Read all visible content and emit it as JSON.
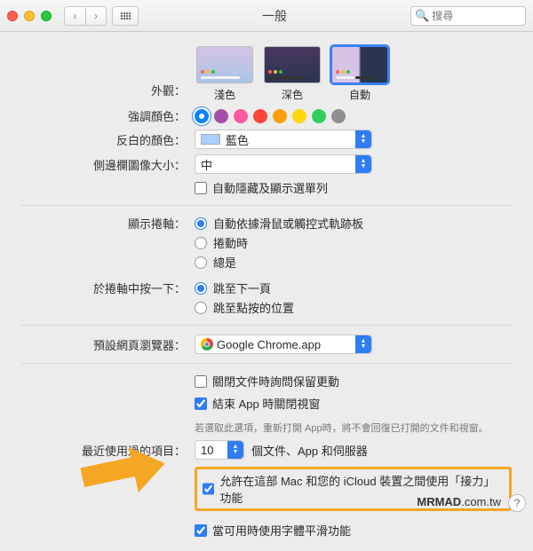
{
  "window": {
    "title": "一般"
  },
  "search": {
    "placeholder": "搜尋"
  },
  "appearance": {
    "label": "外觀：",
    "themes": [
      {
        "name": "淺色",
        "selected": false
      },
      {
        "name": "深色",
        "selected": false
      },
      {
        "name": "自動",
        "selected": true
      }
    ]
  },
  "accent": {
    "label": "強調顏色：",
    "colors": [
      "#0a84ff",
      "#a550a7",
      "#ff5a9e",
      "#ff453a",
      "#ff9f0a",
      "#ffd60a",
      "#30d158",
      "#8e8e93"
    ],
    "selected": 0
  },
  "highlight": {
    "label": "反白的顏色：",
    "value": "藍色",
    "swatch": "#a9d0ff"
  },
  "sidebarSize": {
    "label": "側邊欄圖像大小：",
    "value": "中"
  },
  "autoHideMenu": {
    "checked": false,
    "label": "自動隱藏及顯示選單列"
  },
  "scrollbar": {
    "label": "顯示捲軸：",
    "options": [
      "自動依據滑鼠或觸控式軌跡板",
      "捲動時",
      "總是"
    ],
    "selected": 0
  },
  "scrollbarClick": {
    "label": "於捲軸中按一下：",
    "options": [
      "跳至下一頁",
      "跳至點按的位置"
    ],
    "selected": 0
  },
  "browser": {
    "label": "預設網頁瀏覽器：",
    "value": "Google Chrome.app"
  },
  "docs": {
    "askKeep": {
      "checked": false,
      "label": "關閉文件時詢問保留更動"
    },
    "closeWin": {
      "checked": true,
      "label": "結束 App 時關閉視窗"
    },
    "note": "若選取此選項，重新打開 App時，將不會回復已打開的文件和視窗。"
  },
  "recent": {
    "label": "最近使用過的項目：",
    "count": "10",
    "suffix": "個文件、App 和伺服器"
  },
  "handoff": {
    "checked": true,
    "label": "允許在這部 Mac 和您的 iCloud 裝置之間使用「接力」功能"
  },
  "fontSmoothing": {
    "checked": true,
    "label": "當可用時使用字體平滑功能"
  },
  "watermark": {
    "bold": "MRMAD",
    "rest": ".com.tw"
  },
  "help": "?"
}
